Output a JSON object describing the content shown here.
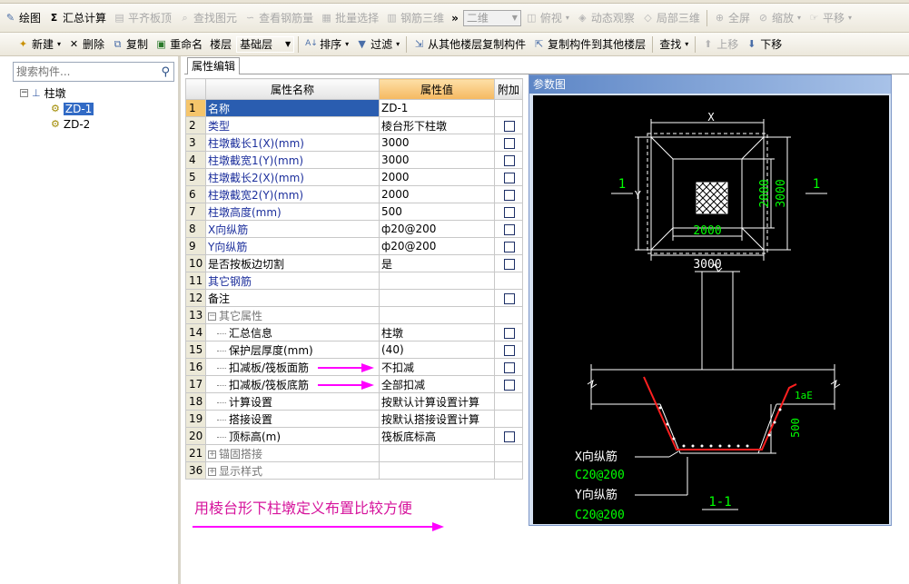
{
  "toolbar1": {
    "items": [
      {
        "label": "绘图",
        "icon": "draw-icon",
        "disabled": false
      },
      {
        "label": "汇总计算",
        "icon": "sigma-icon",
        "disabled": false
      },
      {
        "label": "平齐板顶",
        "icon": "align-icon",
        "disabled": true
      },
      {
        "label": "查找图元",
        "icon": "find-icon",
        "disabled": true
      },
      {
        "label": "查看钢筋量",
        "icon": "view-rebar-icon",
        "disabled": true
      },
      {
        "label": "批量选择",
        "icon": "batch-select-icon",
        "disabled": true
      },
      {
        "label": "钢筋三维",
        "icon": "rebar-3d-icon",
        "disabled": true
      }
    ],
    "overflow": "»",
    "view_mode": "二维",
    "items2": [
      {
        "label": "俯视",
        "icon": "top-view-icon"
      },
      {
        "label": "动态观察",
        "icon": "orbit-icon"
      },
      {
        "label": "局部三维",
        "icon": "local-3d-icon"
      },
      {
        "label": "全屏",
        "icon": "fullscreen-icon"
      },
      {
        "label": "缩放",
        "icon": "zoom-icon"
      },
      {
        "label": "平移",
        "icon": "pan-icon"
      }
    ]
  },
  "toolbar2": {
    "new_label": "新建",
    "delete_label": "删除",
    "copy_label": "复制",
    "rename_label": "重命名",
    "floor_label": "楼层",
    "floor_value": "基础层",
    "sort_label": "排序",
    "filter_label": "过滤",
    "copy_from_label": "从其他楼层复制构件",
    "copy_to_label": "复制构件到其他楼层",
    "find_label": "查找",
    "move_up_label": "上移",
    "move_down_label": "下移"
  },
  "left_panel": {
    "search_placeholder": "搜索构件...",
    "tree_root": "柱墩",
    "tree_items": [
      "ZD-1",
      "ZD-2"
    ]
  },
  "tab": "属性编辑",
  "grid": {
    "headers": [
      "属性名称",
      "属性值",
      "附加"
    ],
    "rows": [
      {
        "num": "1",
        "name": "名称",
        "value": "ZD-1",
        "check": false
      },
      {
        "num": "2",
        "name": "类型",
        "value": "棱台形下柱墩",
        "check": true
      },
      {
        "num": "3",
        "name": "柱墩截长1(X)(mm)",
        "value": "3000",
        "check": true
      },
      {
        "num": "4",
        "name": "柱墩截宽1(Y)(mm)",
        "value": "3000",
        "check": true
      },
      {
        "num": "5",
        "name": "柱墩截长2(X)(mm)",
        "value": "2000",
        "check": true
      },
      {
        "num": "6",
        "name": "柱墩截宽2(Y)(mm)",
        "value": "2000",
        "check": true
      },
      {
        "num": "7",
        "name": "柱墩高度(mm)",
        "value": "500",
        "check": true
      },
      {
        "num": "8",
        "name": "X向纵筋",
        "value": "ф20@200",
        "check": true
      },
      {
        "num": "9",
        "name": "Y向纵筋",
        "value": "ф20@200",
        "check": true
      },
      {
        "num": "10",
        "name": "是否按板边切割",
        "value": "是",
        "check": true
      },
      {
        "num": "11",
        "name": "其它钢筋",
        "value": "",
        "check": false
      },
      {
        "num": "12",
        "name": "备注",
        "value": "",
        "check": true
      },
      {
        "num": "13",
        "name": "其它属性",
        "value": "",
        "check": false,
        "group": "−"
      },
      {
        "num": "14",
        "name": "汇总信息",
        "value": "柱墩",
        "check": true
      },
      {
        "num": "15",
        "name": "保护层厚度(mm)",
        "value": "(40)",
        "check": true
      },
      {
        "num": "16",
        "name": "扣减板/筏板面筋",
        "value": "不扣减",
        "check": true
      },
      {
        "num": "17",
        "name": "扣减板/筏板底筋",
        "value": "全部扣减",
        "check": true
      },
      {
        "num": "18",
        "name": "计算设置",
        "value": "按默认计算设置计算",
        "check": false
      },
      {
        "num": "19",
        "name": "搭接设置",
        "value": "按默认搭接设置计算",
        "check": false
      },
      {
        "num": "20",
        "name": "顶标高(m)",
        "value": "筏板底标高",
        "check": true
      },
      {
        "num": "21",
        "name": "锚固搭接",
        "value": "",
        "check": false,
        "group": "+"
      },
      {
        "num": "36",
        "name": "显示样式",
        "value": "",
        "check": false,
        "group": "+"
      }
    ]
  },
  "note": "用棱台形下柱墩定义布置比较方便",
  "diagram": {
    "title": "参数图",
    "dim_x": "X",
    "dim_y": "Y",
    "inner_w": "2000",
    "outer_w": "3000",
    "inner_h": "2000",
    "outer_h": "3000",
    "section_mark": "1",
    "lae": "1aE",
    "depth": "500",
    "x_rebar_label": "X向纵筋",
    "x_rebar_value": "C20@200",
    "y_rebar_label": "Y向纵筋",
    "y_rebar_value": "C20@200",
    "section_name": "1-1"
  },
  "colors": {
    "accent": "#2a5db0",
    "annotation": "#ff00ff",
    "cad_green": "#00ff00",
    "cad_bg": "#000000"
  }
}
